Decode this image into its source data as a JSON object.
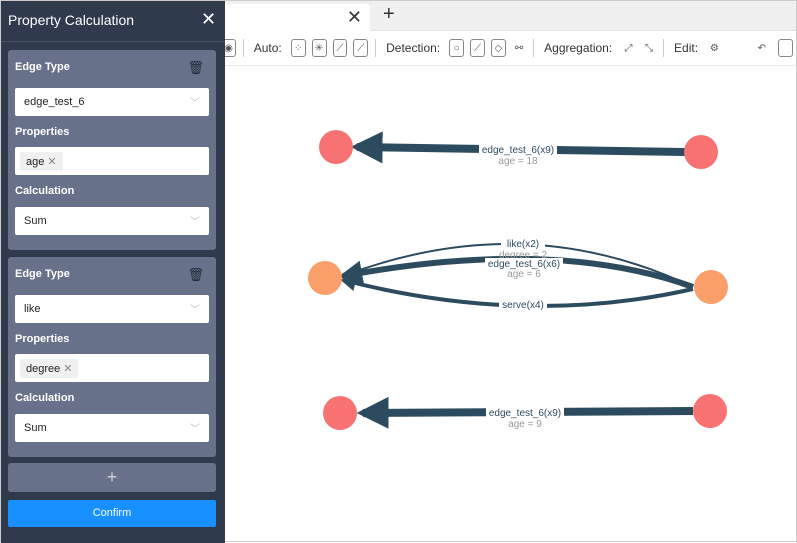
{
  "panel": {
    "title": "Property Calculation",
    "cards": [
      {
        "edge_type_label": "Edge Type",
        "edge_type": "edge_test_6",
        "properties_label": "Properties",
        "property": "age",
        "calculation_label": "Calculation",
        "calculation": "Sum"
      },
      {
        "edge_type_label": "Edge Type",
        "edge_type": "like",
        "properties_label": "Properties",
        "property": "degree",
        "calculation_label": "Calculation",
        "calculation": "Sum"
      }
    ],
    "add": "+",
    "confirm": "Confirm"
  },
  "toolbar": {
    "auto": "Auto:",
    "detection": "Detection:",
    "aggregation": "Aggregation:",
    "edit": "Edit:"
  },
  "graph": {
    "edges": [
      {
        "label": "edge_test_6(x9)",
        "sub": "age = 18"
      },
      {
        "label": "like(x2)",
        "sub": "degree = 2"
      },
      {
        "label": "edge_test_6(x6)",
        "sub": "age = 6"
      },
      {
        "label": "serve(x4)",
        "sub": ""
      },
      {
        "label": "edge_test_6(x9)",
        "sub": "age = 9"
      }
    ],
    "colors": {
      "node_red": "#f87272",
      "node_orange": "#fa9e6a",
      "edge": "#2d4b5e"
    }
  }
}
